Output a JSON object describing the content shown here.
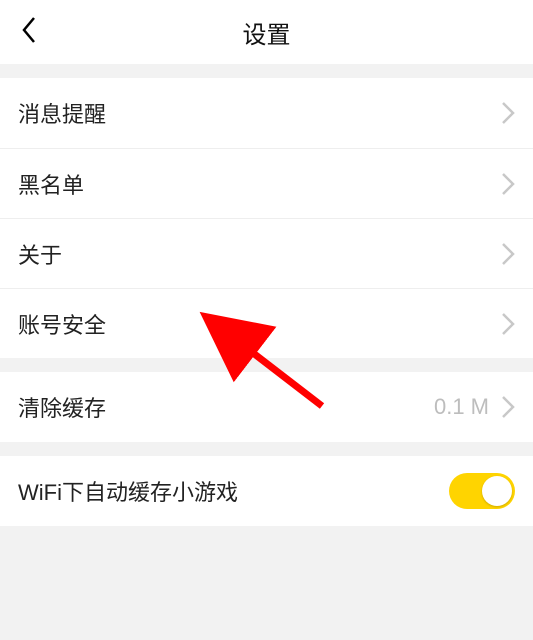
{
  "header": {
    "title": "设置"
  },
  "sections": [
    {
      "rows": [
        {
          "label": "消息提醒"
        },
        {
          "label": "黑名单"
        },
        {
          "label": "关于"
        },
        {
          "label": "账号安全"
        }
      ]
    },
    {
      "rows": [
        {
          "label": "清除缓存",
          "value": "0.1 M"
        }
      ]
    },
    {
      "rows": [
        {
          "label": "WiFi下自动缓存小游戏",
          "toggle": true
        }
      ]
    }
  ]
}
